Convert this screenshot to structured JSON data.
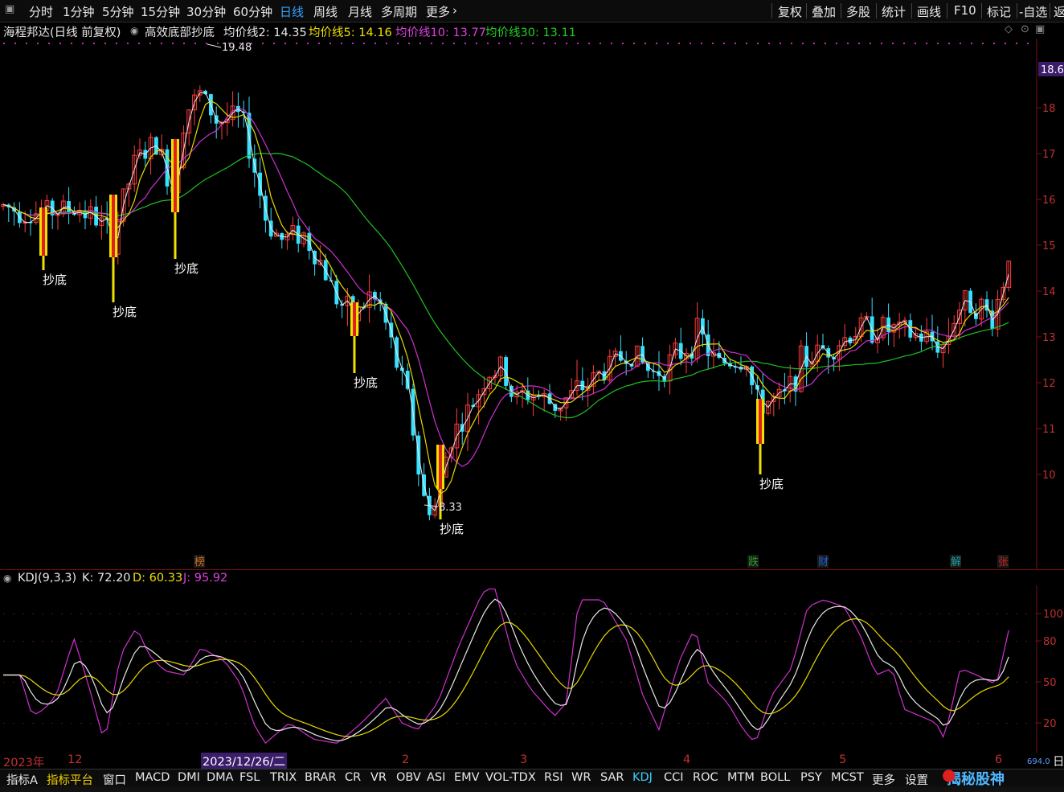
{
  "toolbar": {
    "periods": [
      "分时",
      "1分钟",
      "5分钟",
      "15分钟",
      "30分钟",
      "60分钟",
      "日线",
      "周线",
      "月线",
      "多周期",
      "更多"
    ],
    "active_period": "日线",
    "right": [
      "复权",
      "叠加",
      "多股",
      "统计",
      "画线",
      "F10",
      "标记",
      "-自选",
      "返"
    ]
  },
  "title": {
    "stock": "海程邦达(日线 前复权)",
    "formula": "高效底部抄底",
    "ma_labels": [
      {
        "text": "均价线2: 14.35",
        "color": "#e8e8e8"
      },
      {
        "text": "均价线5: 14.16",
        "color": "#f0e000"
      },
      {
        "text": "均价线10: 13.77",
        "color": "#e040e0"
      },
      {
        "text": "均价线30: 13.11",
        "color": "#20d020"
      }
    ]
  },
  "price_axis": {
    "current_price": "18.6",
    "ticks": [
      "18",
      "17",
      "16",
      "15",
      "14",
      "13",
      "12",
      "11",
      "10"
    ]
  },
  "annotations": {
    "high": "19.48",
    "low": "8.33",
    "signal_text": "抄底"
  },
  "event_markers": [
    {
      "text": "榜",
      "color": "#d07020"
    },
    {
      "text": "跌",
      "color": "#20a020"
    },
    {
      "text": "财",
      "color": "#2060d0"
    },
    {
      "text": "解",
      "color": "#20a0a0"
    },
    {
      "text": "张",
      "color": "#d02020"
    }
  ],
  "kdj": {
    "label": "KDJ(9,3,3)",
    "k": "K: 72.20",
    "d": "D: 60.33",
    "j": "J: 95.92",
    "axis_ticks": [
      "100",
      "80",
      "50",
      "20"
    ]
  },
  "datebar": {
    "year": "2023年",
    "month_12": "12",
    "highlight_date": "2023/12/26/二",
    "months": [
      "2",
      "3",
      "4",
      "5",
      "6"
    ],
    "right_small": "694.0",
    "right_char": "日"
  },
  "indicator_bar": {
    "items": [
      "指标A",
      "指标平台",
      "窗口",
      "MACD",
      "DMI",
      "DMA",
      "FSL",
      "TRIX",
      "BRAR",
      "CR",
      "VR",
      "OBV",
      "ASI",
      "EMV",
      "VOL-TDX",
      "RSI",
      "WR",
      "SAR",
      "KDJ",
      "CCI",
      "ROC",
      "MTM",
      "BOLL",
      "PSY",
      "MCST",
      "更多",
      "设置"
    ],
    "active": "KDJ",
    "watermark": "揭秘股神"
  },
  "chart_data": {
    "type": "candlestick",
    "title": "海程邦达(日线 前复权)",
    "ylim": [
      8.0,
      19.8
    ],
    "period_high": 19.48,
    "period_low": 8.33,
    "ma_latest": {
      "MA2": 14.35,
      "MA5": 14.16,
      "MA10": 13.77,
      "MA30": 13.11
    },
    "kdj_latest": {
      "K": 72.2,
      "D": 60.33,
      "J": 95.92
    },
    "signal_label": "抄底"
  }
}
